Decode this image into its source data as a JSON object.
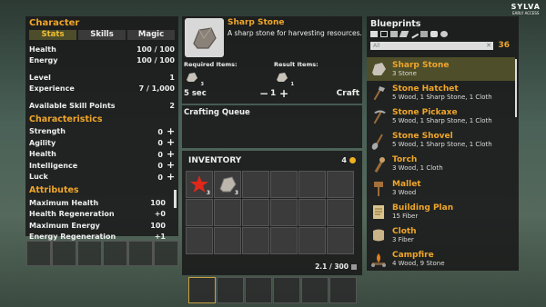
{
  "brand": {
    "name": "SYLVA",
    "tag": "EARLY ACCESS"
  },
  "character": {
    "title": "Character",
    "tabs": [
      "Stats",
      "Skills",
      "Magic"
    ],
    "stats": [
      {
        "label": "Health",
        "value": "100 / 100"
      },
      {
        "label": "Energy",
        "value": "100 / 100"
      }
    ],
    "level": {
      "label": "Level",
      "value": "1"
    },
    "experience": {
      "label": "Experience",
      "value": "7 / 1,000"
    },
    "skill_points": {
      "label": "Available Skill Points",
      "value": "2"
    },
    "characteristics_title": "Characteristics",
    "characteristics": [
      {
        "label": "Strength",
        "value": "0"
      },
      {
        "label": "Agility",
        "value": "0"
      },
      {
        "label": "Health",
        "value": "0"
      },
      {
        "label": "Intelligence",
        "value": "0"
      },
      {
        "label": "Luck",
        "value": "0"
      }
    ],
    "attributes_title": "Attributes",
    "attributes": [
      {
        "label": "Maximum Health",
        "value": "100"
      },
      {
        "label": "Health Regeneration",
        "value": "+0"
      },
      {
        "label": "Maximum Energy",
        "value": "100"
      },
      {
        "label": "Energy Regeneration",
        "value": "+1"
      }
    ]
  },
  "craft": {
    "item_name": "Sharp Stone",
    "description": "A sharp stone for harvesting resources.",
    "required_label": "Required Items:",
    "result_label": "Result Items:",
    "req_count": "3",
    "res_count": "1",
    "time": "5 sec",
    "quantity": "1",
    "craft_button": "Craft",
    "queue_title": "Crafting Queue"
  },
  "inventory": {
    "title": "INVENTORY",
    "coins": "4",
    "slots": [
      {
        "item": "starfish",
        "count": "3"
      },
      {
        "item": "stone",
        "count": "3"
      }
    ],
    "weight": "2.1 / 300"
  },
  "blueprints": {
    "title": "Blueprints",
    "search_placeholder": "All",
    "count": "36",
    "items": [
      {
        "name": "Sharp Stone",
        "req": "3 Stone",
        "icon": "stone"
      },
      {
        "name": "Stone Hatchet",
        "req": "5 Wood, 1 Sharp Stone, 1 Cloth",
        "icon": "hatchet"
      },
      {
        "name": "Stone Pickaxe",
        "req": "5 Wood, 1 Sharp Stone, 1 Cloth",
        "icon": "pickaxe"
      },
      {
        "name": "Stone Shovel",
        "req": "5 Wood, 1 Sharp Stone, 1 Cloth",
        "icon": "shovel"
      },
      {
        "name": "Torch",
        "req": "3 Wood, 1 Cloth",
        "icon": "torch"
      },
      {
        "name": "Mallet",
        "req": "3 Wood",
        "icon": "mallet"
      },
      {
        "name": "Building Plan",
        "req": "15 Fiber",
        "icon": "scroll"
      },
      {
        "name": "Cloth",
        "req": "3 Fiber",
        "icon": "cloth"
      },
      {
        "name": "Campfire",
        "req": "4 Wood, 9 Stone",
        "icon": "campfire"
      }
    ]
  }
}
